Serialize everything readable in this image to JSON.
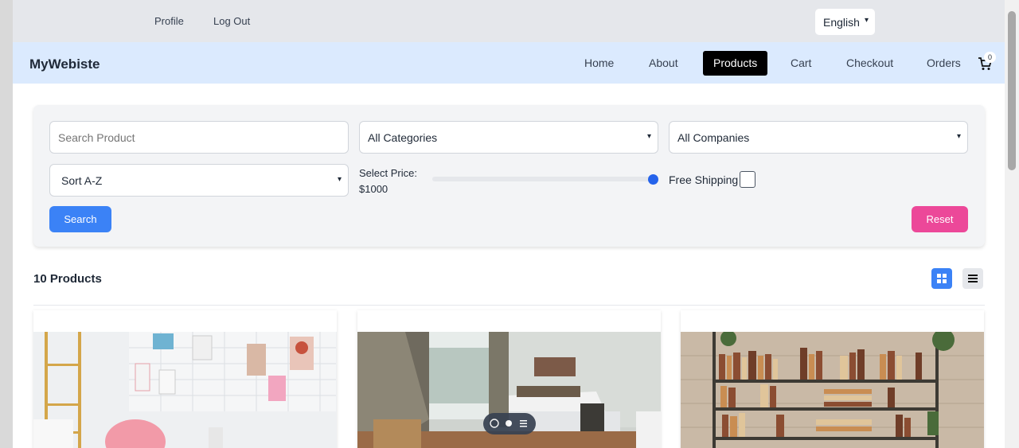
{
  "topbar": {
    "links": [
      "Profile",
      "Log Out"
    ],
    "language": "English"
  },
  "navbar": {
    "brand": "MyWebiste",
    "items": [
      "Home",
      "About",
      "Products",
      "Cart",
      "Checkout",
      "Orders"
    ],
    "active_item": "Products",
    "cart_count": "0"
  },
  "filters": {
    "search_placeholder": "Search Product",
    "category": "All Categories",
    "company": "All Companies",
    "sort": "Sort A-Z",
    "price_label": "Select Price:",
    "price_value": "$1000",
    "price_fraction": 1.0,
    "free_shipping_label": "Free Shipping",
    "free_shipping_checked": false,
    "search_button": "Search",
    "reset_button": "Reset"
  },
  "products": {
    "count_label": "10 Products",
    "view_mode": "grid",
    "images": [
      "room-wall-photo",
      "bedroom-photo",
      "bookshelf-photo"
    ]
  },
  "colors": {
    "nav_bg": "#dbeafe",
    "active_nav": "#000000",
    "search_btn": "#3b82f6",
    "reset_btn": "#ec4899",
    "grid_btn": "#3b82f6"
  }
}
